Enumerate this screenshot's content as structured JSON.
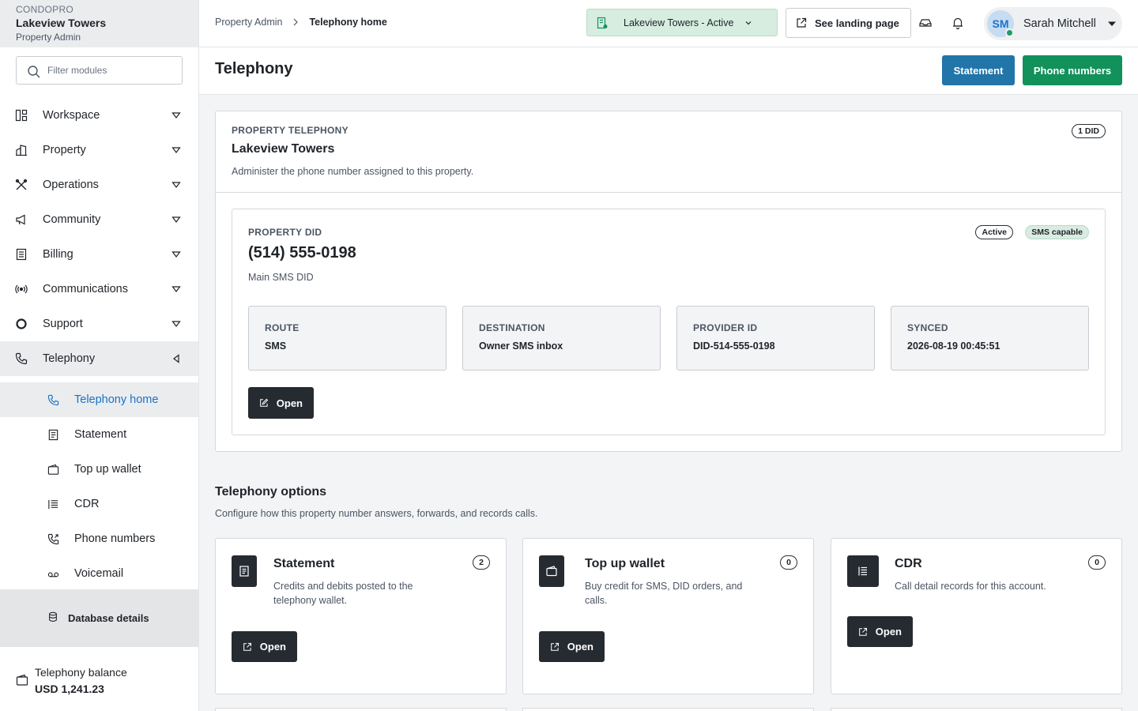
{
  "brand": {
    "app": "CONDOPRO",
    "property": "Lakeview Towers",
    "role": "Property Admin"
  },
  "filter": {
    "placeholder": "Filter modules"
  },
  "nav": [
    {
      "label": "Workspace",
      "icon": "layout-icon"
    },
    {
      "label": "Property",
      "icon": "building-icon"
    },
    {
      "label": "Operations",
      "icon": "tools-icon"
    },
    {
      "label": "Community",
      "icon": "megaphone-icon"
    },
    {
      "label": "Billing",
      "icon": "receipt-icon"
    },
    {
      "label": "Communications",
      "icon": "broadcast-icon"
    },
    {
      "label": "Support",
      "icon": "lifebuoy-icon"
    },
    {
      "label": "Telephony",
      "icon": "phone-icon"
    }
  ],
  "subnav": [
    {
      "label": "Telephony home",
      "icon": "phone-icon",
      "active": true
    },
    {
      "label": "Statement",
      "icon": "receipt-icon"
    },
    {
      "label": "Top up wallet",
      "icon": "wallet-icon"
    },
    {
      "label": "CDR",
      "icon": "list-icon"
    },
    {
      "label": "Phone numbers",
      "icon": "phone-forward-icon"
    },
    {
      "label": "Voicemail",
      "icon": "voicemail-icon"
    }
  ],
  "db": {
    "label": "Database details"
  },
  "balance": {
    "label": "Telephony balance",
    "value": "USD 1,241.23"
  },
  "breadcrumb": {
    "parent": "Property Admin",
    "current": "Telephony home"
  },
  "topbar": {
    "property_select": "Lakeview Towers - Active",
    "landing": "See landing page",
    "user_initials": "SM",
    "user_name": "Sarah Mitchell"
  },
  "page": {
    "title": "Telephony",
    "statement_btn": "Statement",
    "phone_numbers_btn": "Phone numbers"
  },
  "property_telephony": {
    "eyebrow": "PROPERTY TELEPHONY",
    "title": "Lakeview Towers",
    "desc": "Administer the phone number assigned to this property.",
    "did_count": "1 DID"
  },
  "did": {
    "eyebrow": "PROPERTY DID",
    "number": "(514) 555-0198",
    "name": "Main SMS DID",
    "status": "Active",
    "capability": "SMS capable",
    "stats": [
      {
        "k": "ROUTE",
        "v": "SMS"
      },
      {
        "k": "DESTINATION",
        "v": "Owner SMS inbox"
      },
      {
        "k": "PROVIDER ID",
        "v": "DID-514-555-0198"
      },
      {
        "k": "SYNCED",
        "v": "2026-08-19 00:45:51"
      }
    ],
    "open": "Open"
  },
  "options": {
    "title": "Telephony options",
    "desc": "Configure how this property number answers, forwards, and records calls.",
    "cards": [
      {
        "name": "Statement",
        "desc": "Credits and debits posted to the telephony wallet.",
        "count": "2",
        "open": "Open"
      },
      {
        "name": "Top up wallet",
        "desc": "Buy credit for SMS, DID orders, and calls.",
        "count": "0",
        "open": "Open"
      },
      {
        "name": "CDR",
        "desc": "Call detail records for this account.",
        "count": "0",
        "open": "Open"
      }
    ]
  },
  "colors": {
    "primary_blue": "#2175a8",
    "primary_green": "#13915a",
    "active_link": "#1a73c8",
    "dark_button": "#262a31"
  }
}
